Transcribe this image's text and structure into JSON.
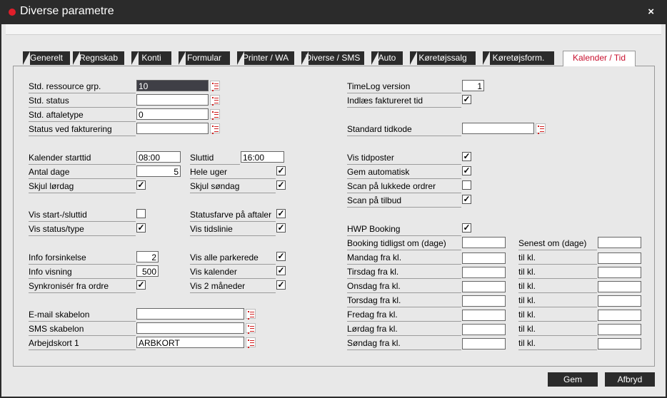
{
  "window": {
    "title": "Diverse parametre",
    "close_glyph": "×"
  },
  "tabs": [
    "Generelt",
    "Regnskab",
    "Konti",
    "Formular",
    "Printer / WA",
    "Diverse / SMS",
    "Auto",
    "Køretøjssalg",
    "Køretøjsform.",
    "Kalender / Tid"
  ],
  "active_tab": "Kalender / Tid",
  "left": {
    "std_ressource_grp": {
      "label": "Std. ressource grp.",
      "value": "10"
    },
    "std_status": {
      "label": "Std. status",
      "value": ""
    },
    "std_aftaletype": {
      "label": "Std. aftaletype",
      "value": "0"
    },
    "status_ved_fakturering": {
      "label": "Status ved fakturering",
      "value": ""
    },
    "kalender_starttid": {
      "label": "Kalender starttid",
      "value": "08:00"
    },
    "sluttid": {
      "label": "Sluttid",
      "value": "16:00"
    },
    "antal_dage": {
      "label": "Antal dage",
      "value": "5"
    },
    "hele_uger": {
      "label": "Hele uger",
      "checked": true
    },
    "skjul_lordag": {
      "label": "Skjul lørdag",
      "checked": true
    },
    "skjul_sondag": {
      "label": "Skjul søndag",
      "checked": true
    },
    "vis_start_sluttid": {
      "label": "Vis start-/sluttid",
      "checked": false
    },
    "statusfarve_pa_aftaler": {
      "label": "Statusfarve på aftaler",
      "checked": true
    },
    "vis_status_type": {
      "label": "Vis status/type",
      "checked": true
    },
    "vis_tidslinie": {
      "label": "Vis tidslinie",
      "checked": true
    },
    "info_forsinkelse": {
      "label": "Info forsinkelse",
      "value": "2"
    },
    "vis_alle_parkerede": {
      "label": "Vis alle parkerede",
      "checked": true
    },
    "info_visning": {
      "label": "Info visning",
      "value": "500"
    },
    "vis_kalender": {
      "label": "Vis kalender",
      "checked": true
    },
    "synkroniser_fra_ordre": {
      "label": "Synkronisér fra ordre",
      "checked": true
    },
    "vis_2_maneder": {
      "label": "Vis 2 måneder",
      "checked": true
    },
    "email_skabelon": {
      "label": "E-mail skabelon",
      "value": ""
    },
    "sms_skabelon": {
      "label": "SMS skabelon",
      "value": ""
    },
    "arbejdskort_1": {
      "label": "Arbejdskort 1",
      "value": "ARBKORT"
    }
  },
  "right": {
    "timelog_version": {
      "label": "TimeLog version",
      "value": "1"
    },
    "indlaes_faktureret_tid": {
      "label": "Indlæs faktureret tid",
      "checked": true
    },
    "standard_tidkode": {
      "label": "Standard tidkode",
      "value": ""
    },
    "vis_tidposter": {
      "label": "Vis tidposter",
      "checked": true
    },
    "gem_automatisk": {
      "label": "Gem automatisk",
      "checked": true
    },
    "scan_lukkede_ordrer": {
      "label": "Scan på lukkede ordrer",
      "checked": false
    },
    "scan_tilbud": {
      "label": "Scan på tilbud",
      "checked": true
    },
    "hwp_booking": {
      "label": "HWP Booking",
      "checked": true
    },
    "booking_tidligst": {
      "label": "Booking tidligst om (dage)",
      "value": ""
    },
    "senest_om": {
      "label": "Senest om (dage)",
      "value": ""
    },
    "til_kl_label": "til kl.",
    "days": [
      {
        "label": "Mandag fra kl.",
        "from": "",
        "to": ""
      },
      {
        "label": "Tirsdag fra kl.",
        "from": "",
        "to": ""
      },
      {
        "label": "Onsdag fra kl.",
        "from": "",
        "to": ""
      },
      {
        "label": "Torsdag fra kl.",
        "from": "",
        "to": ""
      },
      {
        "label": "Fredag fra kl.",
        "from": "",
        "to": ""
      },
      {
        "label": "Lørdag fra kl.",
        "from": "",
        "to": ""
      },
      {
        "label": "Søndag fra kl.",
        "from": "",
        "to": ""
      }
    ]
  },
  "buttons": {
    "save": "Gem",
    "cancel": "Afbryd"
  },
  "colors": {
    "titlebar": "#2b2b2b",
    "accent": "#c8102e",
    "selected_input": "#3f3f46"
  },
  "icons": {
    "lookup": "list-lookup-icon",
    "check": "✓"
  }
}
